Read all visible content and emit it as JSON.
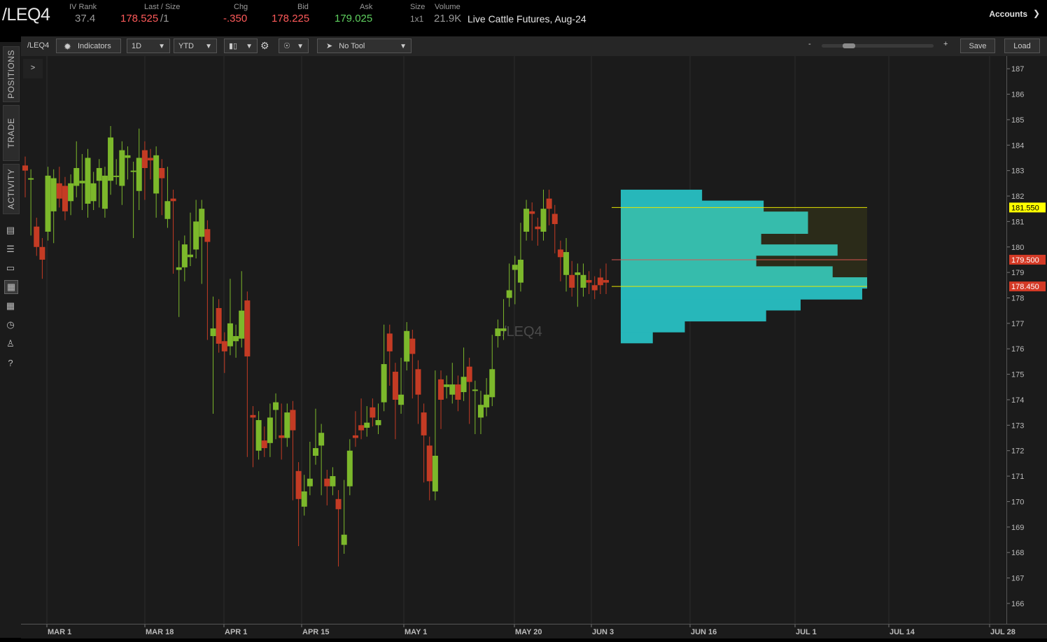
{
  "header": {
    "symbol": "/LEQ4",
    "iv_rank_label": "IV Rank",
    "iv_rank": "37.4",
    "last_label": "Last / Size",
    "last": "178.525",
    "size_sep": "/1",
    "chg_label": "Chg",
    "chg": "-.350",
    "bid_label": "Bid",
    "bid": "178.225",
    "ask_label": "Ask",
    "ask": "179.025",
    "size_label": "Size",
    "size": "1x1",
    "volume_label": "Volume",
    "volume": "21.9K",
    "description": "Live Cattle Futures, Aug-24",
    "accounts": "Accounts"
  },
  "sidebar": {
    "tabs": [
      "POSITIONS",
      "TRADE",
      "ACTIVITY"
    ]
  },
  "toolbar": {
    "symbol": "/LEQ4",
    "indicators": "Indicators",
    "aggregation": "1D",
    "range": "YTD",
    "tool": "No Tool",
    "zoom_minus": "-",
    "zoom_plus": "+",
    "save": "Save",
    "load": "Load",
    "expand": ">"
  },
  "colors": {
    "up": "#7cb82b",
    "down": "#c43b24",
    "profile": "#27b7ba",
    "accent_yellow": "#ffff00",
    "price_red": "#d43a26"
  },
  "chart_data": {
    "type": "candlestick",
    "watermark": "/LEQ4",
    "y_ticks": [
      187,
      186,
      185,
      184,
      183,
      182,
      181,
      180,
      179,
      178,
      177,
      176,
      175,
      174,
      173,
      172,
      171,
      170,
      169,
      168,
      167,
      166
    ],
    "ylim": [
      165.2,
      187.5
    ],
    "x_labels": [
      "MAR 1",
      "MAR 18",
      "APR 1",
      "APR 15",
      "MAY 1",
      "MAY 20",
      "JUN 3",
      "JUN 16",
      "JUL 1",
      "JUL 14",
      "JUL 28"
    ],
    "price_markers": [
      {
        "value": "181.550",
        "color": "yellow"
      },
      {
        "value": "179.500",
        "color": "red"
      },
      {
        "value": "178.450",
        "color": "red"
      }
    ],
    "candles": [
      [
        183.2,
        183.0,
        182.9,
        182.3
      ],
      [
        182.7,
        182.7,
        181.8,
        180.8
      ],
      [
        180.8,
        180.0,
        180.1,
        180.5
      ],
      [
        180.0,
        179.5,
        179.1,
        180.0
      ],
      [
        180.6,
        182.8,
        180.6,
        182.7
      ],
      [
        181.4,
        182.7,
        182.3,
        180.5
      ],
      [
        182.5,
        181.9,
        182.8,
        182.5
      ],
      [
        182.4,
        181.4,
        181.8,
        181.4
      ],
      [
        181.8,
        182.5,
        181.6,
        182.5
      ],
      [
        182.4,
        183.1,
        182.3,
        183.8
      ],
      [
        182.5,
        182.6,
        183.3,
        181.8
      ],
      [
        181.7,
        183.5,
        182.0,
        181.5
      ],
      [
        181.8,
        182.5,
        182.6,
        181.8
      ],
      [
        182.6,
        183.1,
        182.5,
        181.9
      ],
      [
        181.5,
        182.8,
        181.7,
        182.5
      ],
      [
        182.6,
        184.3,
        182.4,
        184.4
      ],
      [
        182.8,
        182.8,
        183.1,
        183.1
      ],
      [
        182.4,
        183.8,
        182.0,
        183.8
      ],
      [
        183.5,
        183.6,
        183.0,
        183.3
      ],
      [
        183.0,
        183.0,
        182.5,
        180.7
      ],
      [
        182.2,
        183.5,
        181.8,
        184.3
      ],
      [
        183.8,
        183.1,
        182.6,
        182.2
      ],
      [
        183.5,
        183.4,
        183.0,
        183.1
      ],
      [
        182.1,
        183.6,
        181.5,
        183.4
      ],
      [
        183.1,
        182.7,
        181.6,
        182.6
      ],
      [
        181.1,
        181.8,
        182.8,
        182.3
      ],
      [
        181.9,
        181.8,
        181.5,
        179.3
      ],
      [
        179.1,
        179.2,
        179.9,
        177.6
      ],
      [
        179.2,
        180.1,
        179.0,
        179.8
      ],
      [
        179.6,
        179.7,
        179.9,
        181.0
      ],
      [
        179.9,
        181.0,
        181.5,
        180.4
      ],
      [
        180.4,
        181.5,
        180.7,
        178.9
      ],
      [
        180.7,
        180.2,
        180.3,
        176.7
      ],
      [
        176.5,
        176.8,
        177.7,
        173.8
      ],
      [
        177.6,
        176.2,
        176.9,
        176.3
      ],
      [
        176.3,
        175.9,
        175.4,
        176.2
      ],
      [
        176.1,
        177.0,
        177.5,
        178.4
      ],
      [
        176.3,
        176.5,
        176.6,
        176.0
      ],
      [
        176.4,
        177.5,
        177.9,
        178.7
      ],
      [
        177.9,
        175.7,
        173.7,
        172.1
      ],
      [
        173.4,
        173.3,
        171.7,
        172.0
      ],
      [
        172.0,
        173.2,
        172.4,
        172.3
      ],
      [
        172.4,
        172.1,
        172.6,
        172.2
      ],
      [
        172.3,
        173.3,
        173.5,
        172.1
      ],
      [
        173.6,
        173.9,
        172.9,
        172.8
      ],
      [
        172.6,
        172.5,
        172.0,
        173.5
      ],
      [
        172.5,
        173.5,
        173.0,
        173.1
      ],
      [
        173.6,
        172.8,
        171.9,
        170.4
      ],
      [
        171.2,
        170.1,
        168.6,
        169.1
      ],
      [
        169.8,
        170.4,
        170.7,
        170.4
      ],
      [
        170.6,
        170.9,
        172.0,
        171.0
      ],
      [
        171.8,
        172.1,
        172.5,
        173.3
      ],
      [
        172.2,
        172.7,
        171.3,
        170.6
      ],
      [
        170.9,
        170.6,
        170.7,
        170.2
      ],
      [
        170.6,
        171.0,
        170.6,
        170.6
      ],
      [
        170.1,
        169.7,
        168.9,
        167.8
      ],
      [
        168.3,
        168.7,
        170.3,
        170.5
      ],
      [
        170.6,
        172.0,
        172.0,
        172.1
      ],
      [
        172.6,
        172.5,
        172.7,
        173.2
      ],
      [
        173.0,
        172.8,
        173.3,
        173.7
      ],
      [
        172.9,
        173.1,
        173.4,
        173.4
      ],
      [
        173.7,
        173.3,
        173.3,
        173.3
      ],
      [
        173.0,
        173.2,
        173.3,
        173.5
      ],
      [
        173.9,
        175.4,
        176.6,
        176.4
      ],
      [
        176.6,
        175.9,
        175.7,
        174.9
      ],
      [
        175.1,
        174.0,
        173.8,
        172.8
      ],
      [
        173.8,
        174.2,
        174.7,
        175.3
      ],
      [
        175.5,
        176.7,
        176.5,
        176.4
      ],
      [
        176.4,
        175.8,
        174.6,
        174.4
      ],
      [
        175.2,
        174.2,
        173.7,
        173.4
      ],
      [
        173.5,
        172.6,
        172.2,
        171.1
      ],
      [
        172.2,
        170.8,
        171.4,
        170.4
      ],
      [
        170.4,
        171.8,
        173.1,
        174.8
      ],
      [
        174.8,
        174.0,
        173.9,
        173.2
      ],
      [
        174.5,
        174.6,
        174.4,
        174.5
      ],
      [
        174.2,
        174.6,
        175.0,
        175.1
      ],
      [
        174.6,
        174.0,
        173.9,
        174.1
      ],
      [
        174.3,
        174.9,
        175.4,
        175.7
      ],
      [
        175.3,
        174.7,
        173.9,
        173.4
      ],
      [
        174.4,
        174.4,
        173.6,
        173.0
      ],
      [
        173.3,
        173.8,
        174.0,
        173.0
      ],
      [
        173.7,
        174.2,
        173.9,
        174.5
      ],
      [
        174.1,
        175.2,
        176.1,
        176.2
      ],
      [
        176.5,
        176.8,
        176.4,
        176.7
      ],
      [
        176.7,
        176.8,
        177.3,
        177.6
      ],
      [
        178.0,
        178.3,
        178.6,
        179.0
      ],
      [
        179.1,
        179.3,
        178.6,
        178.1
      ],
      [
        178.6,
        179.5,
        180.4,
        180.6
      ],
      [
        180.6,
        181.5,
        180.8,
        181.3
      ],
      [
        181.4,
        181.3,
        180.6,
        180.9
      ],
      [
        180.8,
        180.7,
        180.4,
        180.7
      ],
      [
        180.6,
        181.5,
        181.9,
        181.0
      ],
      [
        181.9,
        181.5,
        181.3,
        181.2
      ],
      [
        181.3,
        180.9,
        180.2,
        180.1
      ],
      [
        179.9,
        179.6,
        179.1,
        179.0
      ],
      [
        178.9,
        179.8,
        180.0,
        178.6
      ],
      [
        178.9,
        178.4,
        179.1,
        179.0
      ],
      [
        178.9,
        179.0,
        178.6,
        178.0
      ],
      [
        178.4,
        178.9,
        179.0,
        178.7
      ],
      [
        178.7,
        178.6,
        178.5,
        178.5
      ],
      [
        178.5,
        178.3,
        178.4,
        178.4
      ],
      [
        178.8,
        178.5,
        178.5,
        178.6
      ],
      [
        178.7,
        178.6,
        179.0,
        178.5
      ]
    ],
    "volume_profile": [
      {
        "price": 182.0,
        "width_pct": 0.33
      },
      {
        "price": 181.7,
        "width_pct": 0.58
      },
      {
        "price": 181.4,
        "width_pct": 0.76
      },
      {
        "price": 181.0,
        "width_pct": 0.76
      },
      {
        "price": 180.7,
        "width_pct": 0.57
      },
      {
        "price": 180.4,
        "width_pct": 0.88
      },
      {
        "price": 180.0,
        "width_pct": 0.55
      },
      {
        "price": 179.7,
        "width_pct": 0.86
      },
      {
        "price": 179.4,
        "width_pct": 1.0
      },
      {
        "price": 179.0,
        "width_pct": 0.98
      },
      {
        "price": 178.7,
        "width_pct": 0.73
      },
      {
        "price": 178.4,
        "width_pct": 0.59
      },
      {
        "price": 178.0,
        "width_pct": 0.26
      },
      {
        "price": 177.5,
        "width_pct": 0.13
      }
    ]
  }
}
